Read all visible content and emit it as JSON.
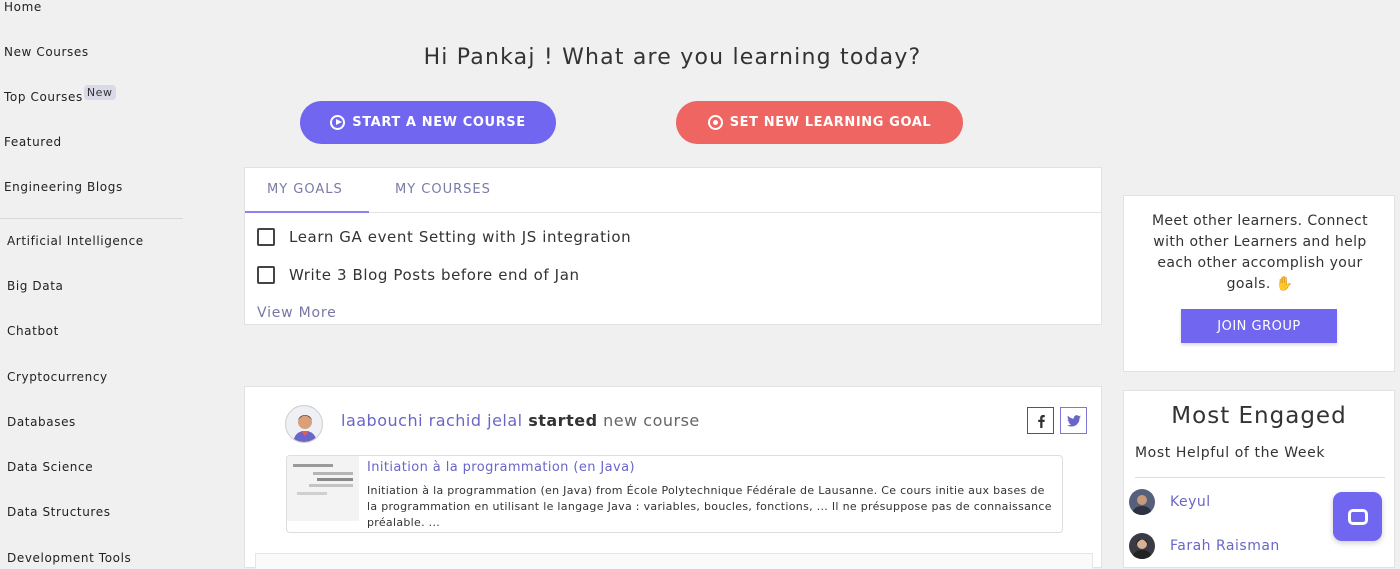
{
  "sidebar": {
    "nav": [
      {
        "label": "Home"
      },
      {
        "label": "New Courses"
      },
      {
        "label": "Top Courses",
        "badge": "New"
      },
      {
        "label": "Featured"
      },
      {
        "label": "Engineering Blogs"
      }
    ],
    "categories": [
      "Artificial Intelligence",
      "Big Data",
      "Chatbot",
      "Cryptocurrency",
      "Databases",
      "Data Science",
      "Data Structures",
      "Development Tools"
    ]
  },
  "header": {
    "greeting": "Hi Pankaj ! What are you learning today?",
    "start_button": "START A NEW COURSE",
    "goal_button": "SET NEW LEARNING GOAL"
  },
  "goals": {
    "tabs": [
      "MY GOALS",
      "MY COURSES"
    ],
    "active_tab": "MY GOALS",
    "items": [
      "Learn GA event Setting with JS integration",
      "Write 3 Blog Posts before end of Jan"
    ],
    "view_more": "View More"
  },
  "feed": {
    "user": "laabouchi rachid jelal",
    "verb": "started",
    "object": "new course",
    "course_title": "Initiation à la programmation (en Java)",
    "course_desc": "Initiation à la programmation (en Java) from École Polytechnique Fédérale de Lausanne. Ce cours initie aux bases de la programmation en utilisant le langage Java : variables, boucles, fonctions, ... Il ne présuppose pas de connaissance préalable. ...",
    "share_facebook_icon": "facebook-icon",
    "share_twitter_icon": "twitter-icon"
  },
  "community": {
    "text": "Meet other learners. Connect with other Learners and help each other accomplish your goals. ✋",
    "join_button": "JOIN GROUP"
  },
  "engaged": {
    "title": "Most Engaged",
    "subtitle": "Most Helpful of the Week",
    "people": [
      "Keyul",
      "Farah Raisman"
    ]
  },
  "colors": {
    "accent": "#7066f0",
    "goal_button": "#ee6561",
    "link": "#6a66c8"
  }
}
